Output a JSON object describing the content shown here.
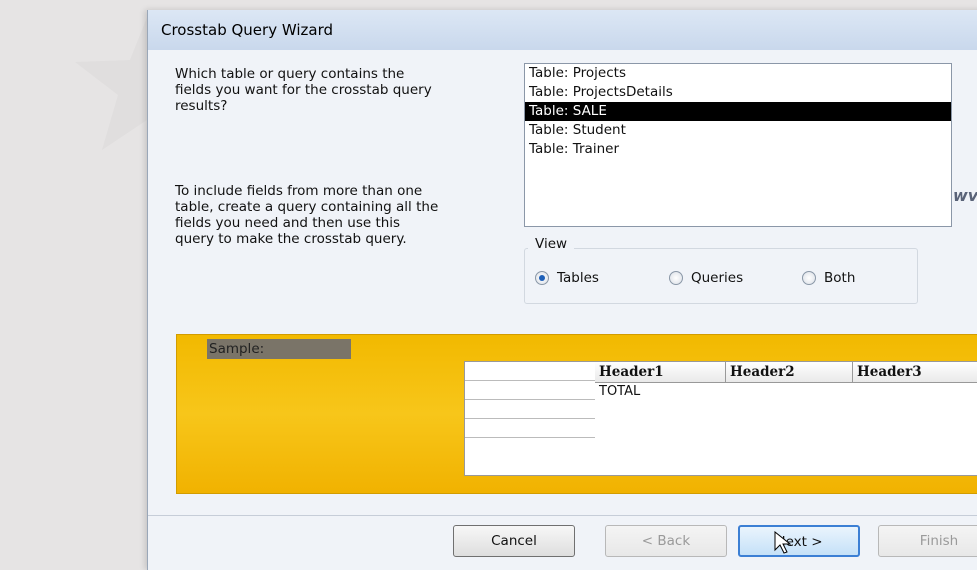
{
  "window": {
    "title": "Crosstab Query Wizard"
  },
  "prompt": {
    "line1": "Which table or query contains the",
    "line2": "fields you want for the crosstab query",
    "line3": "results?"
  },
  "note": {
    "line1": "To include fields from more than one",
    "line2": "table, create a query containing all the",
    "line3": "fields you need and then use this",
    "line4": "query to make the crosstab query."
  },
  "list": {
    "items": [
      "Table: Projects",
      "Table: ProjectsDetails",
      "Table: SALE",
      "Table: Student",
      "Table: Trainer"
    ],
    "selected": "Table: SALE"
  },
  "view": {
    "legend": "View",
    "tables": "Tables",
    "queries": "Queries",
    "both": "Both",
    "selected": "Tables"
  },
  "sample": {
    "label": "Sample:",
    "headers": [
      "Header1",
      "Header2",
      "Header3"
    ],
    "total": "TOTAL"
  },
  "buttons": {
    "cancel": "Cancel",
    "back": "< Back",
    "next": "Next >",
    "finish": "Finish"
  },
  "watermark": {
    "fragment": "wv"
  },
  "colors": {
    "sample_bg": "#f5bd0c",
    "selection": "#000000",
    "default_button": "#3c7fd4"
  }
}
